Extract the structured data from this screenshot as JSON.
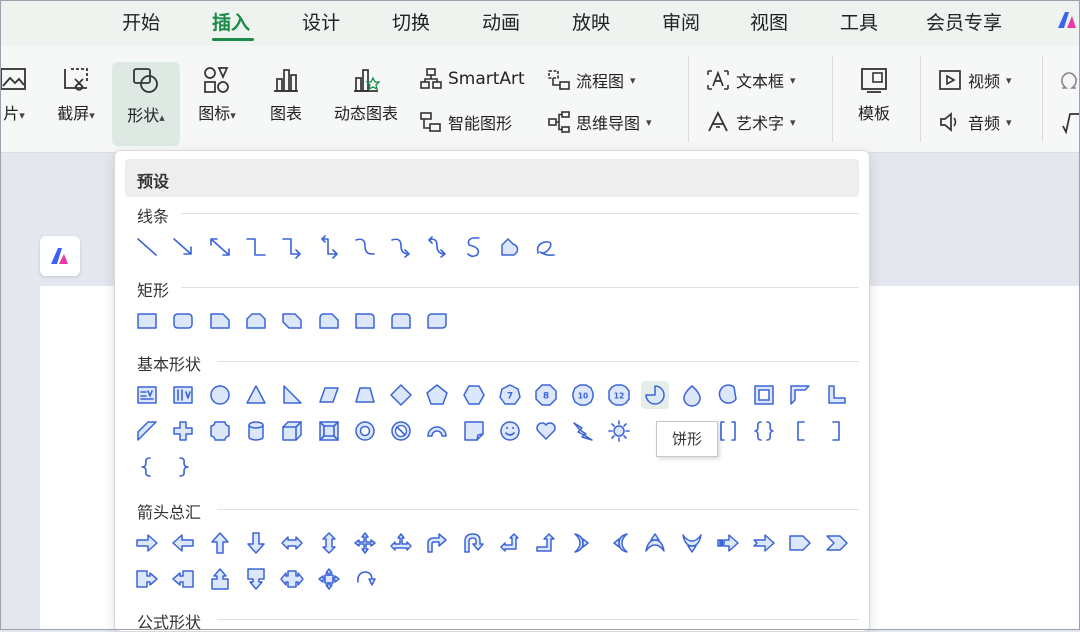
{
  "menu": {
    "tabs": [
      "开始",
      "插入",
      "设计",
      "切换",
      "动画",
      "放映",
      "审阅",
      "视图",
      "工具",
      "会员专享"
    ],
    "active": "插入"
  },
  "ribbon": {
    "picture_label": "片",
    "screenshot_label": "截屏",
    "shapes_label": "形状",
    "icons_label": "图标",
    "chart_label": "图表",
    "dynamic_chart_label": "动态图表",
    "smartart_label": "SmartArt",
    "smart_graphic_label": "智能图形",
    "flowchart_label": "流程图",
    "mindmap_label": "思维导图",
    "textbox_label": "文本框",
    "wordart_label": "艺术字",
    "template_label": "模板",
    "video_label": "视频",
    "audio_label": "音频"
  },
  "dropdown": {
    "header": "预设",
    "categories": {
      "lines": "线条",
      "rectangles": "矩形",
      "basic": "基本形状",
      "arrows": "箭头总汇",
      "formula": "公式形状"
    },
    "badges": [
      "7",
      "8",
      "10",
      "12"
    ],
    "tooltip": "饼形"
  },
  "colors": {
    "accent": "#1b8b48",
    "shape_stroke": "#3b64d8",
    "shape_fill": "#dde7fb"
  }
}
